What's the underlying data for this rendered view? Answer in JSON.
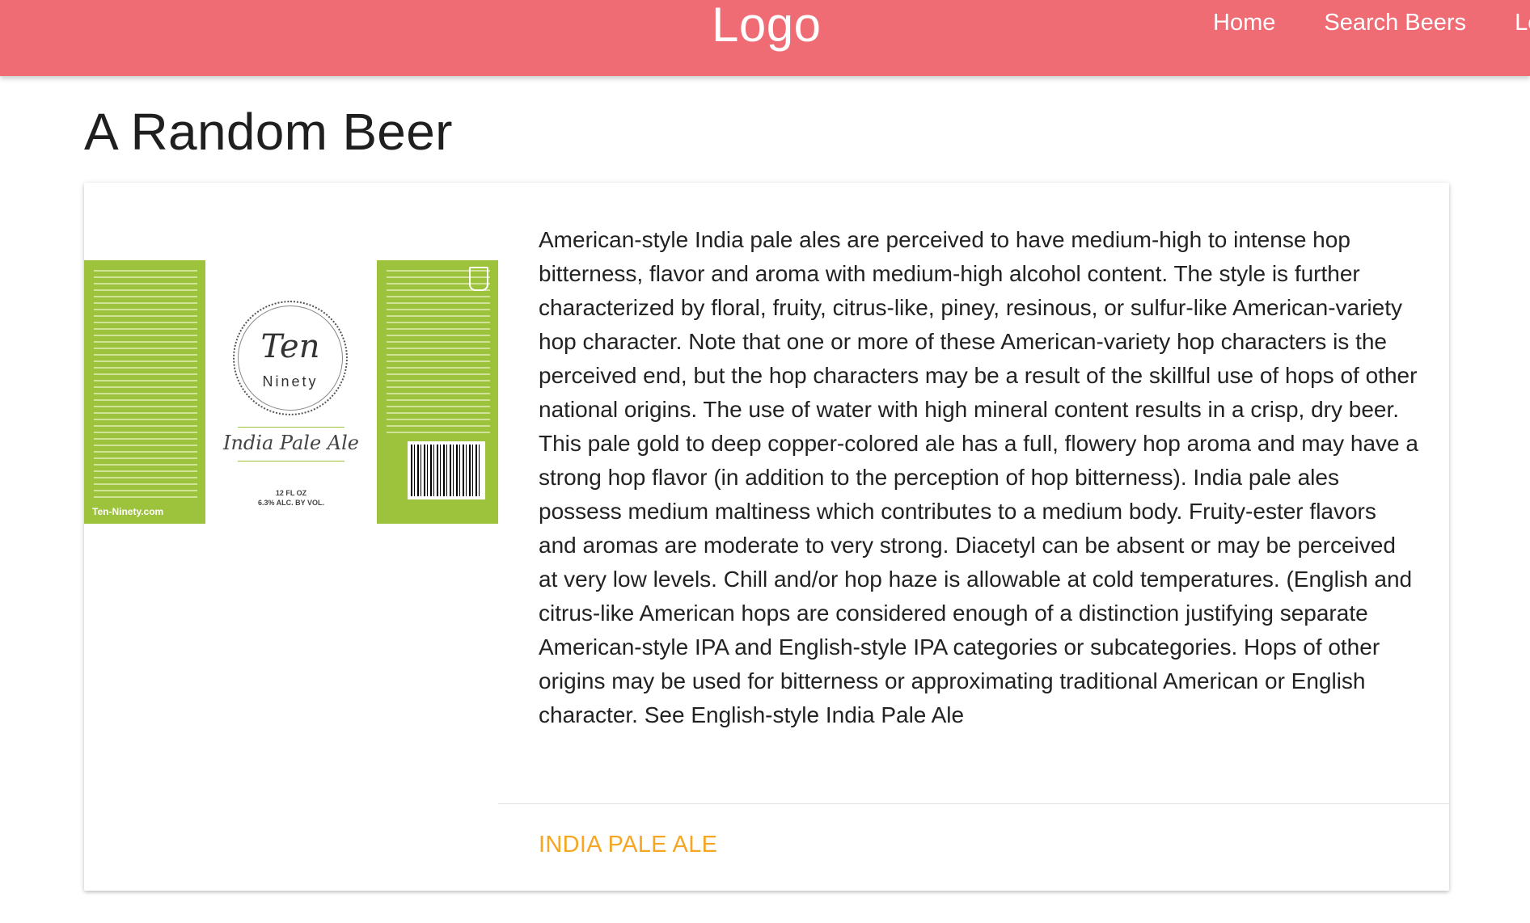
{
  "navbar": {
    "brand": "Logo",
    "links": [
      "Home",
      "Search Beers",
      "Logi"
    ],
    "color": "#ef6c74"
  },
  "page": {
    "title": "A Random Beer"
  },
  "beer": {
    "label": {
      "brand": "Ten",
      "brand_sub": "Ninety",
      "style_script": "India Pale Ale",
      "volume": "12 FL OZ",
      "abv": "6.3% ALC. BY VOL.",
      "website": "Ten-Ninety.com"
    },
    "description": "American-style India pale ales are perceived to have medium-high to intense hop bitterness, flavor and aroma with medium-high alcohol content. The style is further characterized by floral, fruity, citrus-like, piney, resinous, or sulfur-like American-variety hop character. Note that one or more of these American-variety hop characters is the perceived end, but the hop characters may be a result of the skillful use of hops of other national origins. The use of water with high mineral content results in a crisp, dry beer. This pale gold to deep copper-colored ale has a full, flowery hop aroma and may have a strong hop flavor (in addition to the perception of hop bitterness). India pale ales possess medium maltiness which contributes to a medium body. Fruity-ester flavors and aromas are moderate to very strong. Diacetyl can be absent or may be perceived at very low levels. Chill and/or hop haze is allowable at cold temperatures. (English and citrus-like American hops are considered enough of a distinction justifying separate American-style IPA and English-style IPA categories or subcategories. Hops of other origins may be used for bitterness or approximating traditional American or English character. See English-style India Pale Ale",
    "style_link": "India Pale Ale",
    "label_color": "#9dc23c",
    "link_color": "#f5a623"
  }
}
